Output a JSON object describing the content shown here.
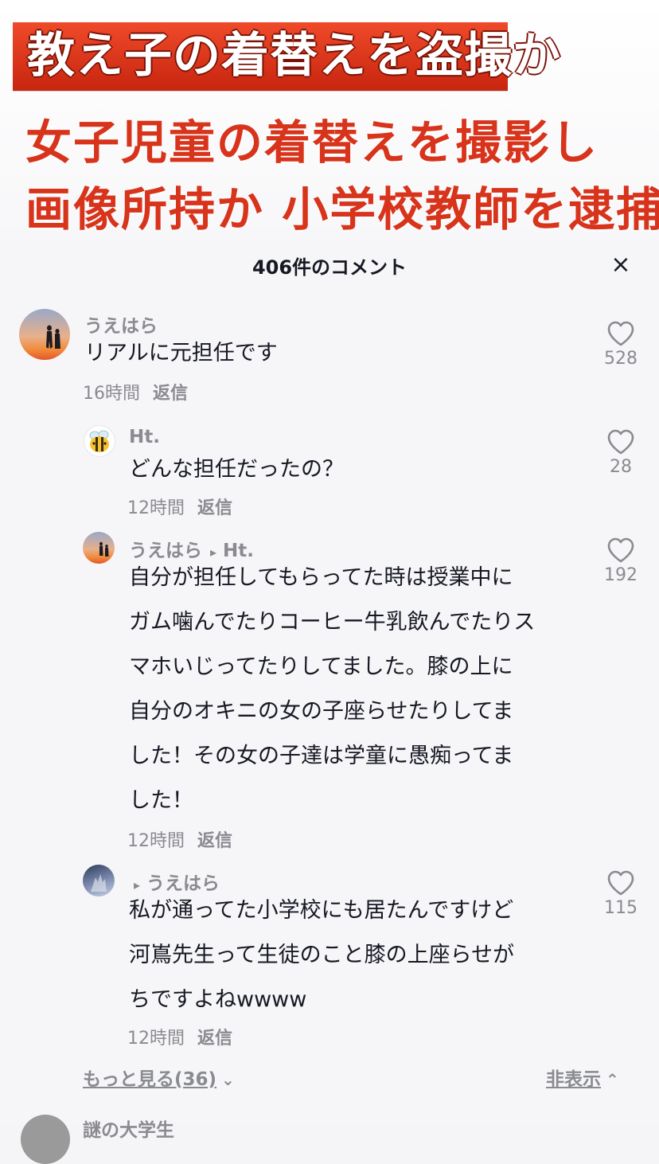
{
  "video": {
    "headline": "教え子の着替えを盗撮か",
    "subline1": "女子児童の着替えを撮影し",
    "subline2": "画像所持か 小学校教師を逮捕"
  },
  "panel": {
    "title": "406件のコメント",
    "close_icon": "×"
  },
  "comments": [
    {
      "username": "うえはら",
      "text": "リアルに元担任です",
      "time": "16時間",
      "reply_label": "返信",
      "likes": "528"
    },
    {
      "username": "Ht.",
      "text": "どんな担任だったの？",
      "time": "12時間",
      "reply_label": "返信",
      "likes": "28"
    },
    {
      "username": "うえはら",
      "reply_to": "Ht.",
      "text": "自分が担任してもらってた時は授業中に\nガム噛んでたりコーヒー牛乳飲んでたりス\nマホいじってたりしてました。膝の上に\n自分のオキニの女の子座らせたりしてま\nした！その女の子達は学童に愚痴ってま\nした！",
      "time": "12時間",
      "reply_label": "返信",
      "likes": "192"
    },
    {
      "username": "",
      "reply_to": "うえはら",
      "text": "私が通ってた小学校にも居たんですけど\n河嶌先生って生徒のこと膝の上座らせが\nちですよねwwww",
      "time": "12時間",
      "reply_label": "返信",
      "likes": "115"
    }
  ],
  "footer": {
    "more_label": "もっと見る(36)",
    "hide_label": "非表示",
    "next_username": "謎の大学生"
  },
  "icons": {
    "heart": "heart-icon",
    "chevron_down": "chevron-down-icon",
    "chevron_up": "chevron-up-icon",
    "reply_arrow": "▸"
  }
}
